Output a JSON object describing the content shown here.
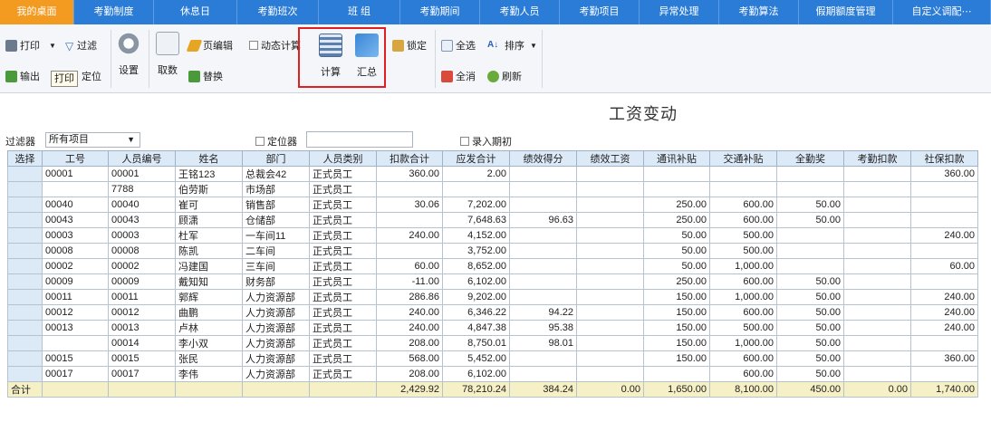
{
  "topnav": {
    "tabs": [
      "我的桌面",
      "考勤制度",
      "休息日",
      "考勤班次",
      "班 组",
      "考勤期间",
      "考勤人员",
      "考勤项目",
      "异常处理",
      "考勤算法",
      "假期额度管理",
      "自定义调配⋯"
    ]
  },
  "ribbon": {
    "print": "打印",
    "filter": "过滤",
    "export": "输出",
    "locate": "定位",
    "tooltip": "打印",
    "settings": "设置",
    "fetch": "取数",
    "page_edit": "页编辑",
    "dynamic_calc": "动态计算",
    "replace": "替换",
    "calculate": "计算",
    "summary": "汇总",
    "lock": "锁定",
    "select_all": "全选",
    "sort": "排序",
    "deselect_all": "全消",
    "refresh": "刷新"
  },
  "page_title": "工资变动",
  "filter": {
    "label": "过滤器",
    "value": "所有项目",
    "locator_label": "定位器",
    "entry_period_label": "录入期初"
  },
  "table": {
    "headers": [
      "选择",
      "工号",
      "人员编号",
      "姓名",
      "部门",
      "人员类别",
      "扣款合计",
      "应发合计",
      "绩效得分",
      "绩效工资",
      "通讯补贴",
      "交通补贴",
      "全勤奖",
      "考勤扣款",
      "社保扣款"
    ],
    "rows": [
      [
        "",
        "00001",
        "00001",
        "王铭123",
        "总裁会42",
        "正式员工",
        "360.00",
        "2.00",
        "",
        "",
        "",
        "",
        "",
        "",
        "360.00"
      ],
      [
        "",
        "",
        "7788",
        "伯劳斯",
        "市场部",
        "正式员工",
        "",
        "",
        "",
        "",
        "",
        "",
        "",
        "",
        ""
      ],
      [
        "",
        "00040",
        "00040",
        "崔可",
        "销售部",
        "正式员工",
        "30.06",
        "7,202.00",
        "",
        "",
        "250.00",
        "600.00",
        "50.00",
        "",
        ""
      ],
      [
        "",
        "00043",
        "00043",
        "顾潇",
        "仓储部",
        "正式员工",
        "",
        "7,648.63",
        "96.63",
        "",
        "250.00",
        "600.00",
        "50.00",
        "",
        ""
      ],
      [
        "",
        "00003",
        "00003",
        "杜军",
        "一车间11",
        "正式员工",
        "240.00",
        "4,152.00",
        "",
        "",
        "50.00",
        "500.00",
        "",
        "",
        "240.00"
      ],
      [
        "",
        "00008",
        "00008",
        "陈凯",
        "二车间",
        "正式员工",
        "",
        "3,752.00",
        "",
        "",
        "50.00",
        "500.00",
        "",
        "",
        ""
      ],
      [
        "",
        "00002",
        "00002",
        "冯建国",
        "三车间",
        "正式员工",
        "60.00",
        "8,652.00",
        "",
        "",
        "50.00",
        "1,000.00",
        "",
        "",
        "60.00"
      ],
      [
        "",
        "00009",
        "00009",
        "戴知知",
        "财务部",
        "正式员工",
        "-11.00",
        "6,102.00",
        "",
        "",
        "250.00",
        "600.00",
        "50.00",
        "",
        ""
      ],
      [
        "",
        "00011",
        "00011",
        "郭辉",
        "人力资源部",
        "正式员工",
        "286.86",
        "9,202.00",
        "",
        "",
        "150.00",
        "1,000.00",
        "50.00",
        "",
        "240.00"
      ],
      [
        "",
        "00012",
        "00012",
        "曲鹏",
        "人力资源部",
        "正式员工",
        "240.00",
        "6,346.22",
        "94.22",
        "",
        "150.00",
        "600.00",
        "50.00",
        "",
        "240.00"
      ],
      [
        "",
        "00013",
        "00013",
        "卢林",
        "人力资源部",
        "正式员工",
        "240.00",
        "4,847.38",
        "95.38",
        "",
        "150.00",
        "500.00",
        "50.00",
        "",
        "240.00"
      ],
      [
        "",
        "",
        "00014",
        "李小双",
        "人力资源部",
        "正式员工",
        "208.00",
        "8,750.01",
        "98.01",
        "",
        "150.00",
        "1,000.00",
        "50.00",
        "",
        ""
      ],
      [
        "",
        "00015",
        "00015",
        "张民",
        "人力资源部",
        "正式员工",
        "568.00",
        "5,452.00",
        "",
        "",
        "150.00",
        "600.00",
        "50.00",
        "",
        "360.00"
      ],
      [
        "",
        "00017",
        "00017",
        "李伟",
        "人力资源部",
        "正式员工",
        "208.00",
        "6,102.00",
        "",
        "",
        "",
        "600.00",
        "50.00",
        "",
        ""
      ]
    ],
    "total": [
      "合计",
      "",
      "",
      "",
      "",
      "",
      "2,429.92",
      "78,210.24",
      "384.24",
      "0.00",
      "1,650.00",
      "8,100.00",
      "450.00",
      "0.00",
      "1,740.00"
    ]
  },
  "colors": {
    "nav": "#2b7cd6",
    "nav_active": "#f39a21",
    "header": "#dce9f7",
    "total_row": "#f6f0c6",
    "highlight_box": "#e02020"
  }
}
